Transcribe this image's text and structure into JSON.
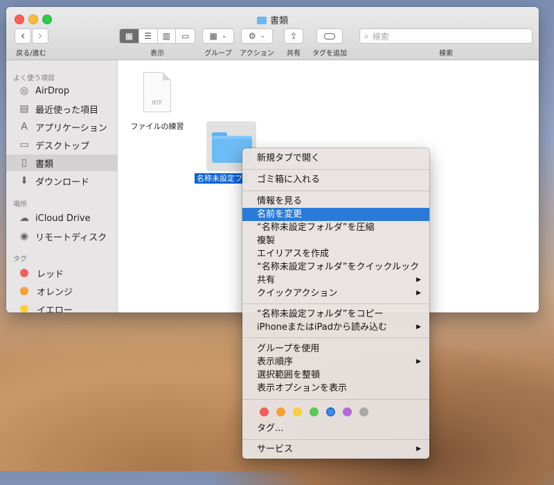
{
  "window": {
    "title": "書類"
  },
  "toolbar": {
    "nav_label": "戻る/進む",
    "back": "‹",
    "forward": "›",
    "view_label": "表示",
    "group_label": "グループ",
    "action_label": "アクション",
    "share_label": "共有",
    "tag_label": "タグを追加",
    "search_label": "検索",
    "search_placeholder": "検索"
  },
  "sidebar": {
    "favorites_header": "よく使う項目",
    "favorites": [
      {
        "label": "AirDrop",
        "icon": "airdrop-icon"
      },
      {
        "label": "最近使った項目",
        "icon": "recents-icon"
      },
      {
        "label": "アプリケーション",
        "icon": "applications-icon"
      },
      {
        "label": "デスクトップ",
        "icon": "desktop-icon"
      },
      {
        "label": "書類",
        "icon": "documents-icon",
        "selected": true
      },
      {
        "label": "ダウンロード",
        "icon": "downloads-icon"
      }
    ],
    "places_header": "場所",
    "places": [
      {
        "label": "iCloud Drive",
        "icon": "cloud-icon"
      },
      {
        "label": "リモートディスク",
        "icon": "disc-icon"
      }
    ],
    "tags_header": "タグ",
    "tags": [
      {
        "label": "レッド",
        "color": "#f0605a"
      },
      {
        "label": "オレンジ",
        "color": "#f5a03a"
      },
      {
        "label": "イエロー",
        "color": "#f7cf3f"
      }
    ]
  },
  "files": [
    {
      "name": "ファイルの練習",
      "type_label": "RTF"
    },
    {
      "name": "名称未設定フォルダ",
      "selected": true
    }
  ],
  "context_menu": {
    "items": [
      {
        "label": "新規タブで開く"
      },
      {
        "label": "ゴミ箱に入れる"
      },
      {
        "label": "情報を見る"
      },
      {
        "label": "名前を変更",
        "highlighted": true
      },
      {
        "label": "“名称未設定フォルダ”を圧縮"
      },
      {
        "label": "複製"
      },
      {
        "label": "エイリアスを作成"
      },
      {
        "label": "“名称未設定フォルダ”をクイックルック"
      },
      {
        "label": "共有",
        "submenu": true
      },
      {
        "label": "クイックアクション",
        "submenu": true
      },
      {
        "label": "“名称未設定フォルダ”をコピー"
      },
      {
        "label": "iPhoneまたはiPadから読み込む",
        "submenu": true
      },
      {
        "label": "グループを使用"
      },
      {
        "label": "表示順序",
        "submenu": true
      },
      {
        "label": "選択範囲を整頓"
      },
      {
        "label": "表示オプションを表示"
      },
      {
        "label": "タグ..."
      },
      {
        "label": "サービス",
        "submenu": true
      }
    ],
    "submenu_arrow": "▶",
    "tag_colors": [
      "#f0605a",
      "#f5a03a",
      "#f7cf3f",
      "#5ac85a",
      "#3d8ef0",
      "#b36ad8",
      "#a8a8a8"
    ]
  }
}
